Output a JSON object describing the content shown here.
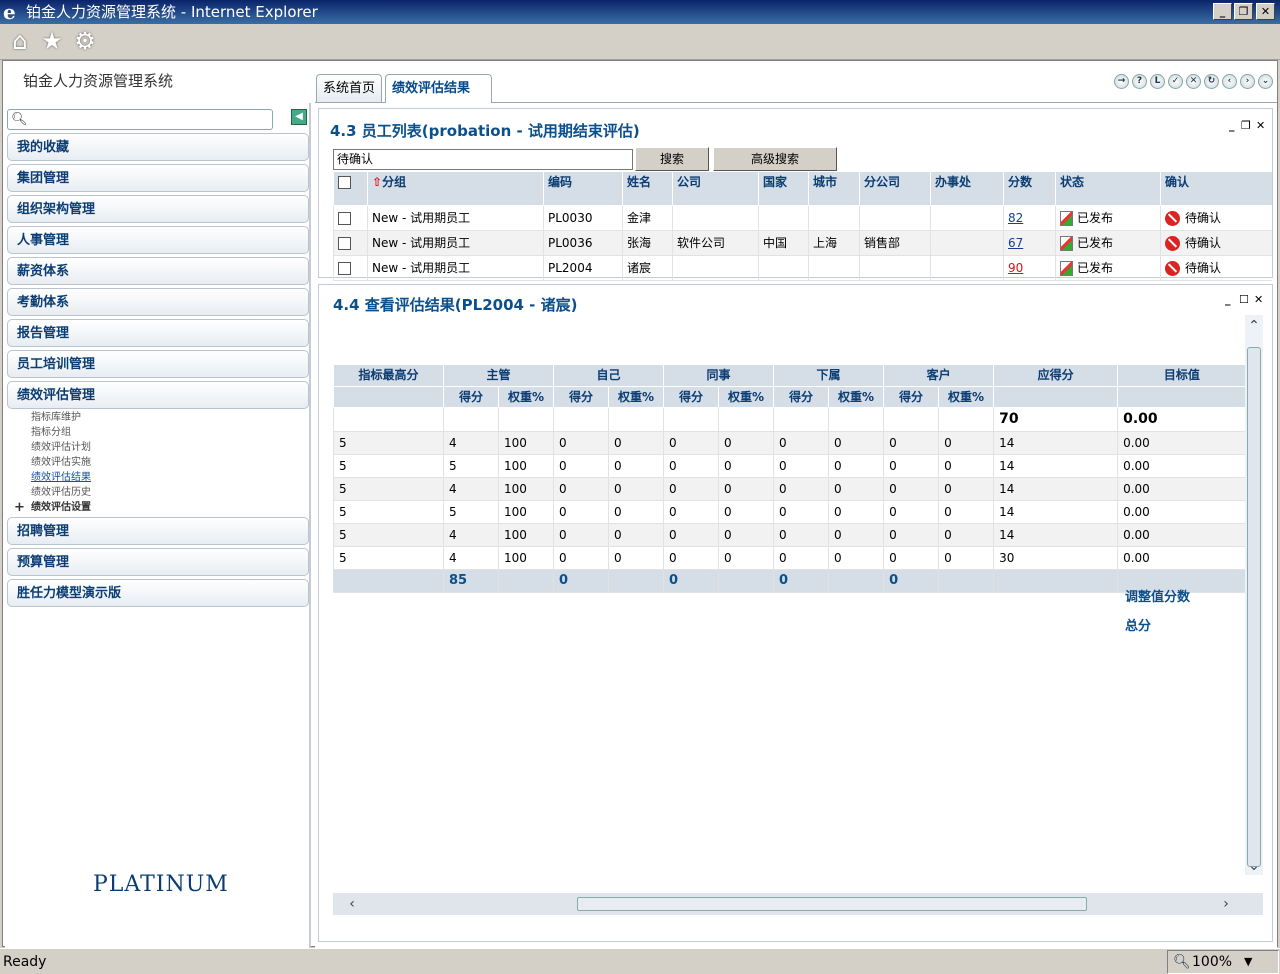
{
  "window": {
    "title": "铂金人力资源管理系统 - Internet Explorer"
  },
  "app": {
    "name": "铂金人力资源管理系统",
    "logo_text": "PLATINUM"
  },
  "tabs": [
    {
      "label": "系统首页"
    },
    {
      "label": "绩效评估结果",
      "active": true
    }
  ],
  "sidebar": {
    "menus": [
      {
        "label": "我的收藏"
      },
      {
        "label": "集团管理"
      },
      {
        "label": "组织架构管理"
      },
      {
        "label": "人事管理"
      },
      {
        "label": "薪资体系"
      },
      {
        "label": "考勤体系"
      },
      {
        "label": "报告管理"
      },
      {
        "label": "员工培训管理"
      },
      {
        "label": "绩效评估管理"
      },
      {
        "label": "招聘管理"
      },
      {
        "label": "预算管理"
      },
      {
        "label": "胜任力模型演示版"
      }
    ],
    "submenu": [
      "指标库维护",
      "指标分组",
      "绩效评估计划",
      "绩效评估实施",
      "绩效评估结果",
      "绩效评估历史"
    ],
    "submenu_expandable": "绩效评估设置"
  },
  "employee_panel": {
    "title": "4.3 员工列表(probation - 试用期结束评估)",
    "filter_value": "待确认",
    "search_label": "搜索",
    "advanced_search_label": "高级搜索",
    "columns": [
      "分组",
      "编码",
      "姓名",
      "公司",
      "国家",
      "城市",
      "分公司",
      "办事处",
      "分数",
      "状态",
      "确认"
    ],
    "rows": [
      {
        "group": "New - 试用期员工",
        "code": "PL0030",
        "name": "金津",
        "company": "",
        "country": "",
        "city": "",
        "branch": "",
        "office": "",
        "score": "82",
        "status": "已发布",
        "confirm": "待确认"
      },
      {
        "group": "New - 试用期员工",
        "code": "PL0036",
        "name": "张海",
        "company": "软件公司",
        "country": "中国",
        "city": "上海",
        "branch": "销售部",
        "office": "",
        "score": "67",
        "status": "已发布",
        "confirm": "待确认"
      },
      {
        "group": "New - 试用期员工",
        "code": "PL2004",
        "name": "诸宸",
        "company": "",
        "country": "",
        "city": "",
        "branch": "",
        "office": "",
        "score": "90",
        "status": "已发布",
        "confirm": "待确认"
      }
    ]
  },
  "result_panel": {
    "title": "4.4 查看评估结果(PL2004 - 诸宸)",
    "group_headers": [
      "指标最高分",
      "主管",
      "自己",
      "同事",
      "下属",
      "客户",
      "应得分",
      "目标值"
    ],
    "sub_headers": [
      "得分",
      "权重%"
    ],
    "total_row": {
      "due": "70",
      "target": "0.00"
    },
    "rows": [
      [
        "5",
        "4",
        "100",
        "0",
        "0",
        "0",
        "0",
        "0",
        "0",
        "0",
        "0",
        "14",
        "0.00"
      ],
      [
        "5",
        "5",
        "100",
        "0",
        "0",
        "0",
        "0",
        "0",
        "0",
        "0",
        "0",
        "14",
        "0.00"
      ],
      [
        "5",
        "4",
        "100",
        "0",
        "0",
        "0",
        "0",
        "0",
        "0",
        "0",
        "0",
        "14",
        "0.00"
      ],
      [
        "5",
        "5",
        "100",
        "0",
        "0",
        "0",
        "0",
        "0",
        "0",
        "0",
        "0",
        "14",
        "0.00"
      ],
      [
        "5",
        "4",
        "100",
        "0",
        "0",
        "0",
        "0",
        "0",
        "0",
        "0",
        "0",
        "14",
        "0.00"
      ],
      [
        "5",
        "4",
        "100",
        "0",
        "0",
        "0",
        "0",
        "0",
        "0",
        "0",
        "0",
        "30",
        "0.00"
      ]
    ],
    "footer": [
      "",
      "85",
      "",
      "0",
      "",
      "0",
      "",
      "0",
      "",
      "0",
      "",
      "",
      ""
    ],
    "adjust_label": "调整值分数",
    "total_label": "总分"
  },
  "status": {
    "text": "Ready",
    "zoom": "100%"
  }
}
